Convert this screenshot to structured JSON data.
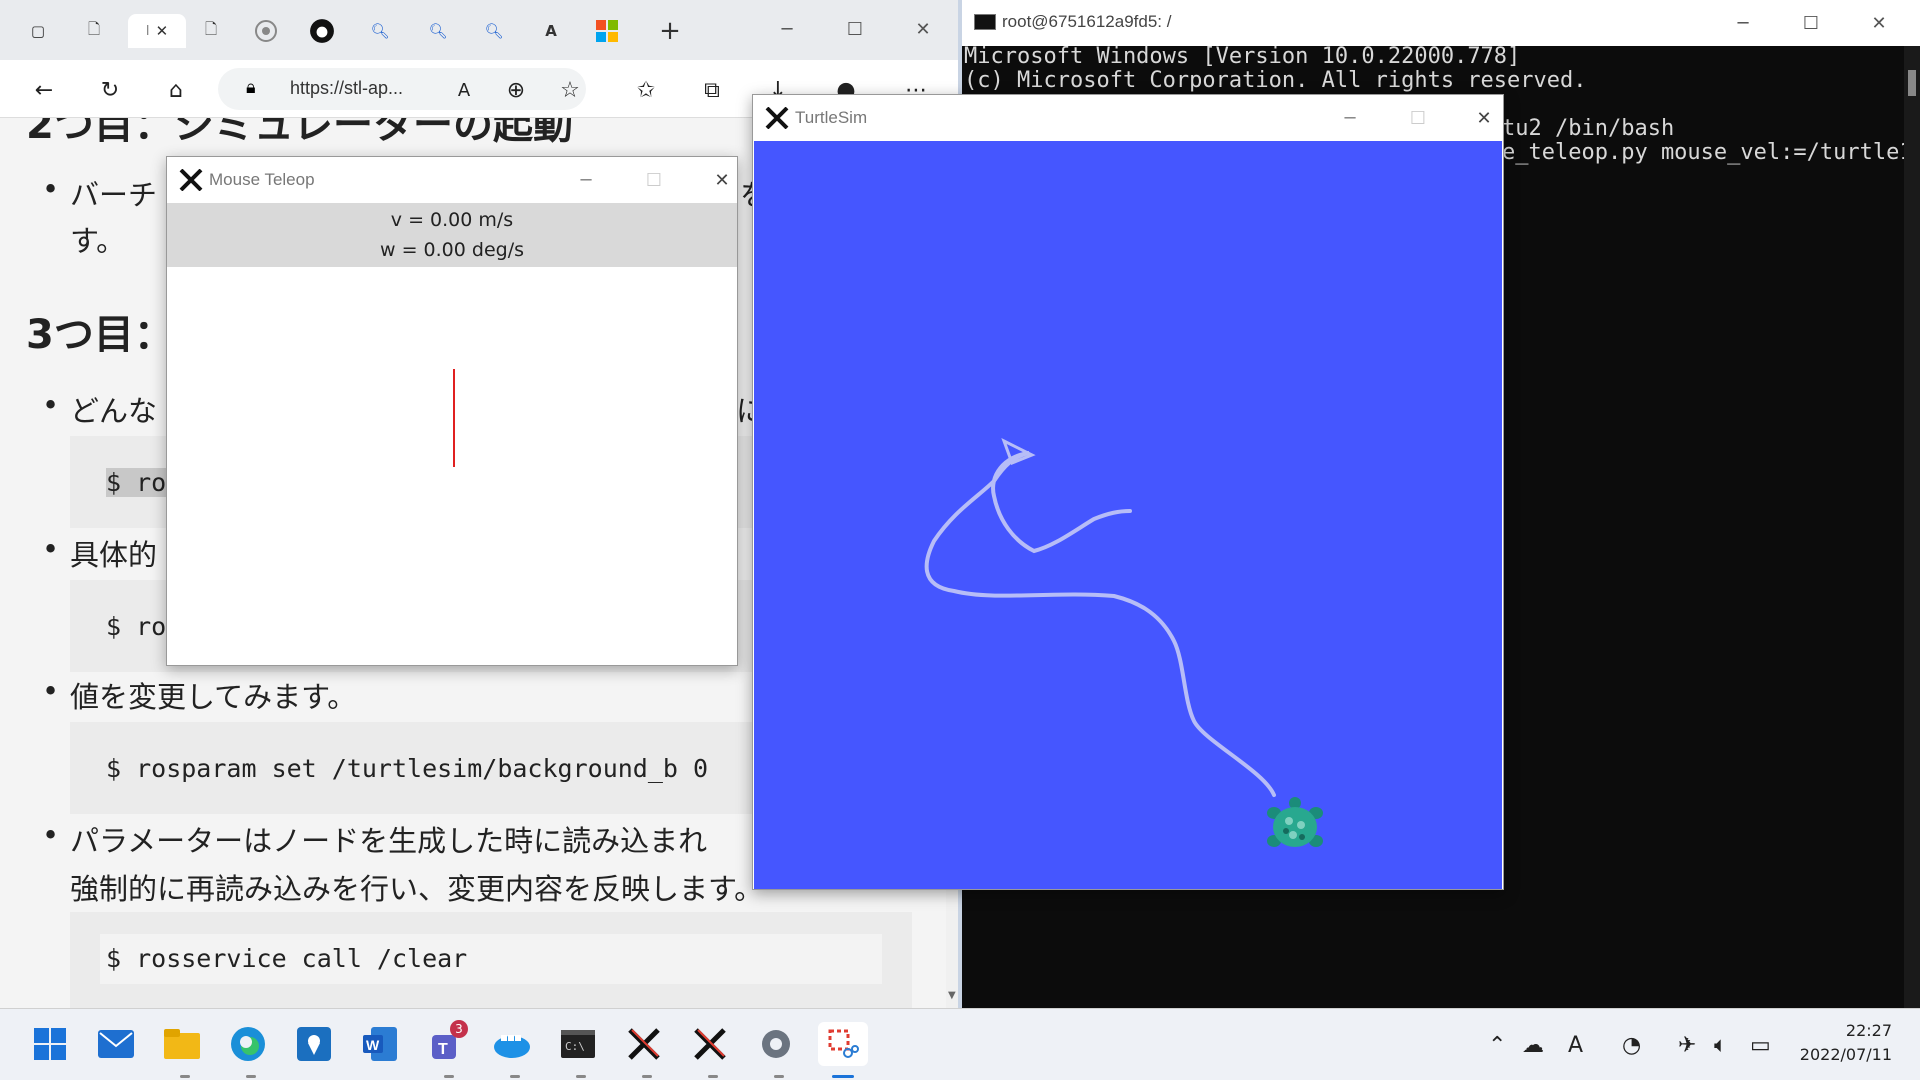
{
  "browser": {
    "url": "https://stl-ap...",
    "tabs": [
      "",
      "",
      "",
      "",
      "",
      "",
      "",
      "",
      "",
      ""
    ],
    "tab_active_label": "I"
  },
  "doc": {
    "heading_partial": "2つ目：シミュレーターの起動",
    "bullet1_a": "バーチ",
    "bullet1_suffix": "を",
    "bullet1_b": "す。",
    "heading3": "3つ目：",
    "bullet2": "どんな",
    "bullet2_suffix": "に",
    "code1": "$ ro",
    "bullet3": "具体的",
    "code2": "$ ro",
    "bullet4": "値を変更してみます。",
    "code3": "$ rosparam set /turtlesim/background_b 0",
    "bullet5_a": "パラメーターはノードを生成した時に読み込まれ",
    "bullet5_b": "強制的に再読み込みを行い、変更内容を反映します。",
    "code4": "$ rosservice call /clear"
  },
  "terminal": {
    "title": "root@6751612a9fd5: /",
    "line1": "Microsoft Windows [Version 10.0.22000.778]",
    "line2": "(c) Microsoft Corporation. All rights reserved.",
    "line3": "tu2 /bin/bash",
    "line4": "e_teleop.py mouse_vel:=/turtle1/"
  },
  "teleop": {
    "title": "Mouse Teleop",
    "v": "v = 0.00 m/s",
    "w": "w = 0.00 deg/s"
  },
  "turtlesim": {
    "title": "TurtleSim",
    "background": "#4556ff"
  },
  "taskbar": {
    "teams_badge": "3",
    "time": "22:27",
    "date": "2022/07/11",
    "ime": "A"
  }
}
